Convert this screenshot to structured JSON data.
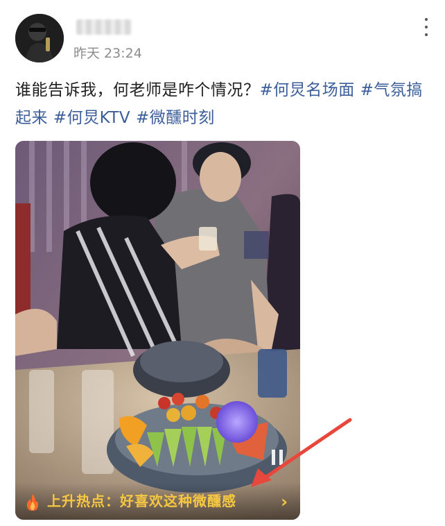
{
  "post": {
    "timestamp": "昨天 23:24",
    "text": "谁能告诉我，何老师是咋个情况？",
    "hashtags": [
      "#何炅名场面",
      "#气氛搞起来",
      "#何炅KTV",
      "#微醺时刻"
    ]
  },
  "video": {
    "hot_topic_text": "上升热点：好喜欢这种微醺感",
    "chevron": "›"
  },
  "icons": [
    "more-icon",
    "fire-icon",
    "chevron-right-icon",
    "pause-icon"
  ],
  "colors": {
    "hashtag": "#3b5e9a",
    "hot_text": "#f6c842",
    "arrow": "#e8473c"
  }
}
